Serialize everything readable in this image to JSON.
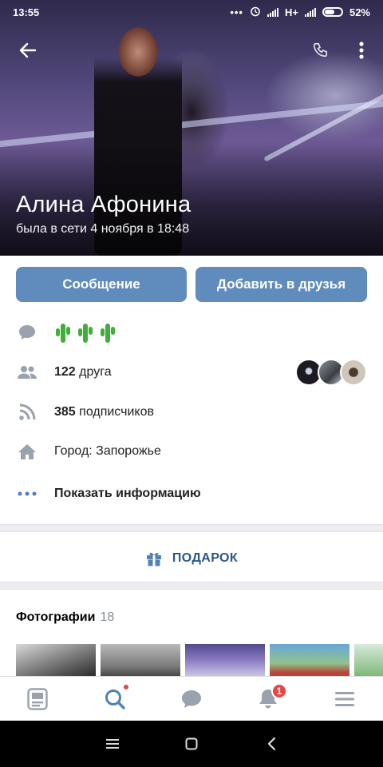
{
  "status_bar": {
    "time": "13:55",
    "network": "H+",
    "battery": "52%"
  },
  "profile": {
    "name": "Алина Афонина",
    "last_seen": "была в сети 4 ноября в 18:48"
  },
  "actions": {
    "message_label": "Сообщение",
    "add_friend_label": "Добавить в друзья"
  },
  "info": {
    "status_emoji_icon": "cactus-icon",
    "friends_count": "122",
    "friends_label": "друга",
    "followers_count": "385",
    "followers_label": "подписчиков",
    "city": "Город: Запорожье",
    "show_info_label": "Показать информацию"
  },
  "gift": {
    "label": "ПОДАРОК"
  },
  "photos": {
    "title": "Фотографии",
    "count": "18"
  },
  "tabbar": {
    "notifications_badge": "1"
  },
  "colors": {
    "primary_button": "#5f8bbd",
    "link": "#2a5885",
    "icon_gray": "#99a2ad",
    "badge_red": "#e64646"
  }
}
